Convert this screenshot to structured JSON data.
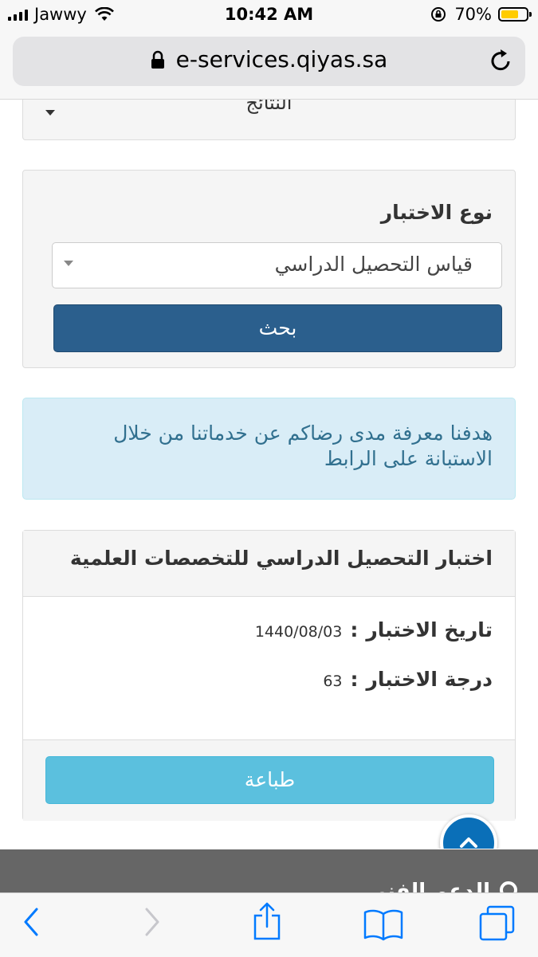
{
  "status_bar": {
    "carrier": "Jawwy",
    "time": "10:42 AM",
    "battery": "70%",
    "battery_level": 0.7
  },
  "browser": {
    "url": "e-services.qiyas.sa"
  },
  "results_select": {
    "label": "النتائج"
  },
  "test_type_panel": {
    "title": "نوع الاختبار",
    "selected_value": "قياس التحصيل الدراسي",
    "search_button": "بحث"
  },
  "alert": {
    "message": "هدفنا معرفة مدى رضاكم عن خدماتنا من خلال الاستبانة على الرابط"
  },
  "result_card": {
    "title": "اختبار التحصيل الدراسي للتخصصات العلمية",
    "date_label": "تاريخ الاختبار",
    "date_value": "1440/08/03",
    "grade_label": "درجة الاختبار",
    "grade_value": "63",
    "colon": ":",
    "print_button": "طباعة"
  },
  "footer": {
    "partial_text": "الدعم الفني"
  },
  "colors": {
    "primary_button": "#2b5f8d",
    "info_button": "#5bc0de",
    "alert_bg": "#d9edf7",
    "alert_text": "#31708f",
    "ios_blue": "#007aff"
  }
}
